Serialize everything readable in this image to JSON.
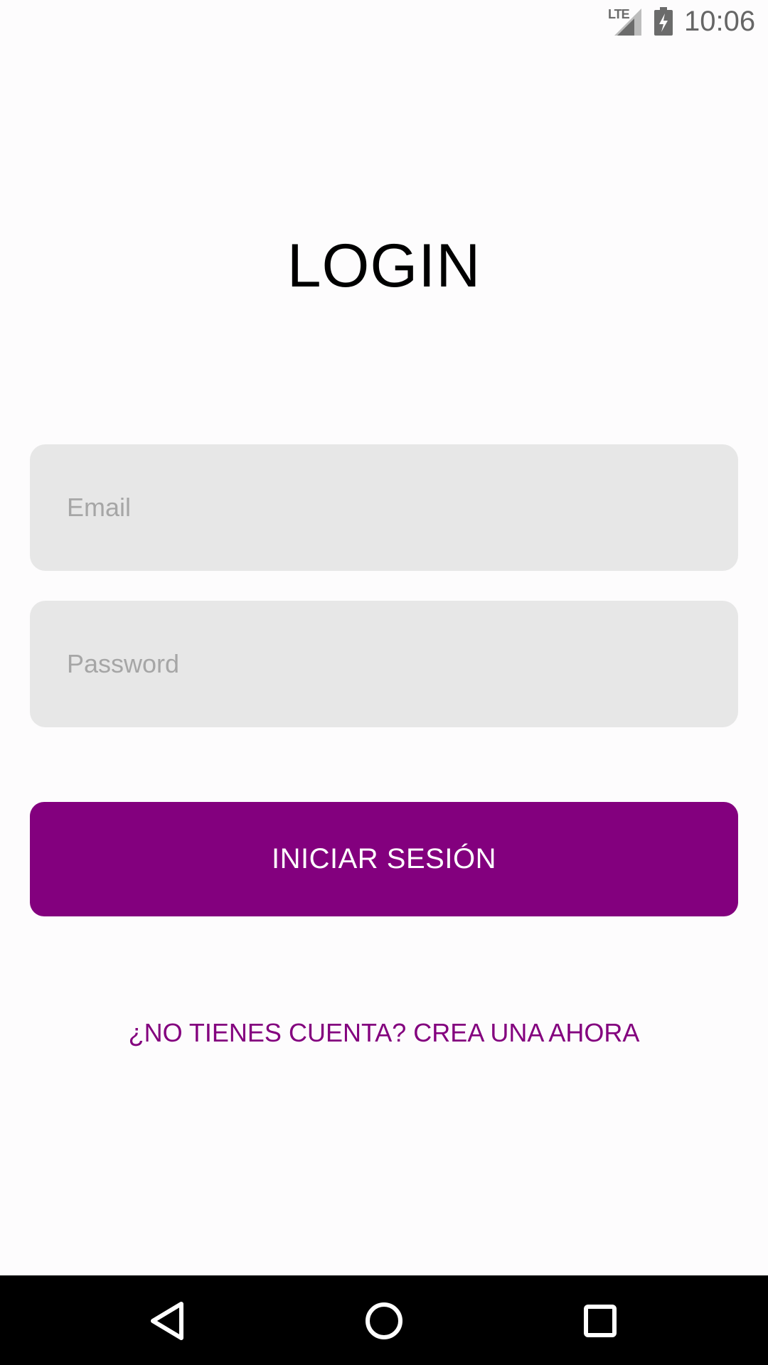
{
  "status_bar": {
    "network": "LTE",
    "time": "10:06",
    "icons": [
      "lte-signal-icon",
      "battery-charging-icon"
    ]
  },
  "title": "LOGIN",
  "form": {
    "email_placeholder": "Email",
    "email_value": "",
    "password_placeholder": "Password",
    "password_value": "",
    "submit_label": "INICIAR SESIÓN"
  },
  "register_link": "¿NO TIENES CUENTA? CREA UNA AHORA",
  "nav_bar": {
    "icons": [
      "back-icon",
      "home-icon",
      "recents-icon"
    ]
  },
  "colors": {
    "accent": "#83007e",
    "field_bg": "#e7e7e7",
    "background": "#fdfcfd"
  }
}
